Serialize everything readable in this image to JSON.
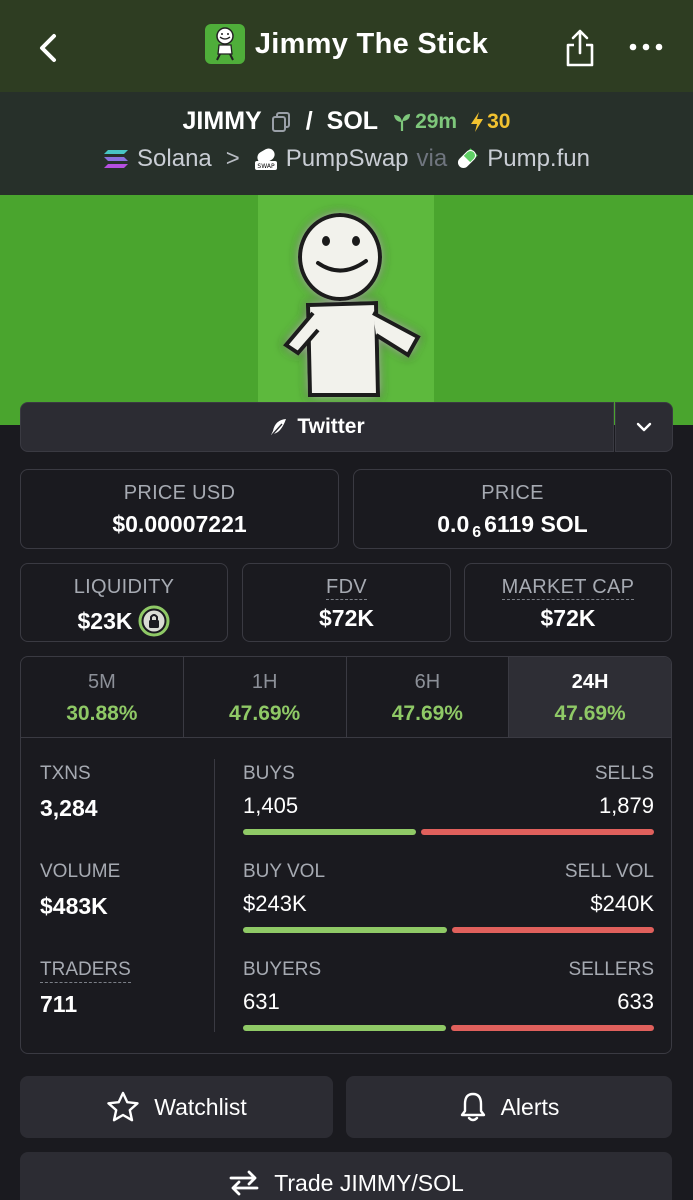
{
  "header": {
    "title": "Jimmy The Stick",
    "back_icon": "chevron-left-icon",
    "share_icon": "share-icon",
    "more_icon": "more-dots-icon"
  },
  "pair": {
    "base": "JIMMY",
    "quote": "SOL",
    "age": "29m",
    "boosts": "30",
    "chain": "Solana",
    "dex": "PumpSwap",
    "via_label": "via",
    "launchpad": "Pump.fun"
  },
  "links": {
    "twitter_label": "Twitter"
  },
  "price": {
    "usd_label": "PRICE USD",
    "usd_value": "$0.00007221",
    "native_label": "PRICE",
    "native_prefix": "0.0",
    "native_zeros": "6",
    "native_digits": "6119 SOL"
  },
  "metrics": {
    "liquidity_label": "LIQUIDITY",
    "liquidity_value": "$23K",
    "fdv_label": "FDV",
    "fdv_value": "$72K",
    "mcap_label": "MARKET CAP",
    "mcap_value": "$72K"
  },
  "timeframes": [
    {
      "label": "5M",
      "change": "30.88%"
    },
    {
      "label": "1H",
      "change": "47.69%"
    },
    {
      "label": "6H",
      "change": "47.69%"
    },
    {
      "label": "24H",
      "change": "47.69%"
    }
  ],
  "stats": {
    "txns_label": "TXNS",
    "txns_value": "3,284",
    "volume_label": "VOLUME",
    "volume_value": "$483K",
    "traders_label": "TRADERS",
    "traders_value": "711",
    "buys_label": "BUYS",
    "buys_value": "1,405",
    "sells_label": "SELLS",
    "sells_value": "1,879",
    "buys_ratio": 0.428,
    "buyvol_label": "BUY VOL",
    "buyvol_value": "$243K",
    "sellvol_label": "SELL VOL",
    "sellvol_value": "$240K",
    "buyvol_ratio": 0.503,
    "buyers_label": "BUYERS",
    "buyers_value": "631",
    "sellers_label": "SELLERS",
    "sellers_value": "633",
    "buyers_ratio": 0.499
  },
  "actions": {
    "watchlist_label": "Watchlist",
    "alerts_label": "Alerts",
    "trade_label": "Trade JIMMY/SOL"
  },
  "colors": {
    "positive": "#8fc966",
    "negative": "#e0605c",
    "boost": "#f2c230",
    "background": "#1a1a1f"
  }
}
